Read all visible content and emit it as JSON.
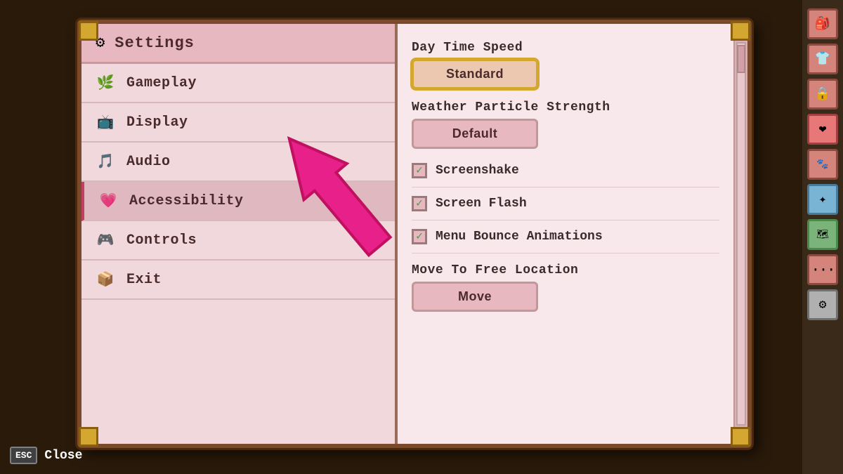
{
  "header": {
    "title": "Settings",
    "gear_icon": "⚙"
  },
  "nav": {
    "items": [
      {
        "id": "gameplay",
        "label": "Gameplay",
        "icon": "🌿",
        "active": false
      },
      {
        "id": "display",
        "label": "Display",
        "icon": "📺",
        "active": false
      },
      {
        "id": "audio",
        "label": "Audio",
        "icon": "🎵",
        "active": false
      },
      {
        "id": "accessibility",
        "label": "Accessibility",
        "icon": "💗",
        "active": true
      },
      {
        "id": "controls",
        "label": "Controls",
        "icon": "🎮",
        "active": false
      },
      {
        "id": "exit",
        "label": "Exit",
        "icon": "📦",
        "active": false
      }
    ]
  },
  "right_panel": {
    "sections": [
      {
        "id": "daytime-speed",
        "label": "Day Time Speed",
        "type": "button",
        "value": "Standard",
        "selected": true
      },
      {
        "id": "weather-particle",
        "label": "Weather Particle Strength",
        "type": "button",
        "value": "Default",
        "selected": false
      },
      {
        "id": "screenshake",
        "label": "Screenshake",
        "type": "checkbox",
        "checked": true
      },
      {
        "id": "screen-flash",
        "label": "Screen Flash",
        "type": "checkbox",
        "checked": true
      },
      {
        "id": "menu-bounce",
        "label": "Menu Bounce Animations",
        "type": "checkbox",
        "checked": true
      },
      {
        "id": "move-to-free",
        "label": "Move To Free Location",
        "type": "button",
        "value": "Move",
        "selected": false
      }
    ]
  },
  "footer": {
    "esc_label": "ESC",
    "close_label": "Close"
  },
  "sidebar_icons": [
    {
      "id": "backpack",
      "icon": "🎒",
      "style": "normal"
    },
    {
      "id": "shirt",
      "icon": "👕",
      "style": "normal"
    },
    {
      "id": "lock",
      "icon": "🔒",
      "style": "normal"
    },
    {
      "id": "heart",
      "icon": "❤",
      "style": "heart"
    },
    {
      "id": "buddy",
      "icon": "🐾",
      "style": "normal"
    },
    {
      "id": "star",
      "icon": "✦",
      "style": "special"
    },
    {
      "id": "map",
      "icon": "🗺",
      "style": "map"
    },
    {
      "id": "ellipsis",
      "icon": "⋯",
      "style": "normal"
    },
    {
      "id": "gear-bottom",
      "icon": "⚙",
      "style": "gear"
    }
  ]
}
